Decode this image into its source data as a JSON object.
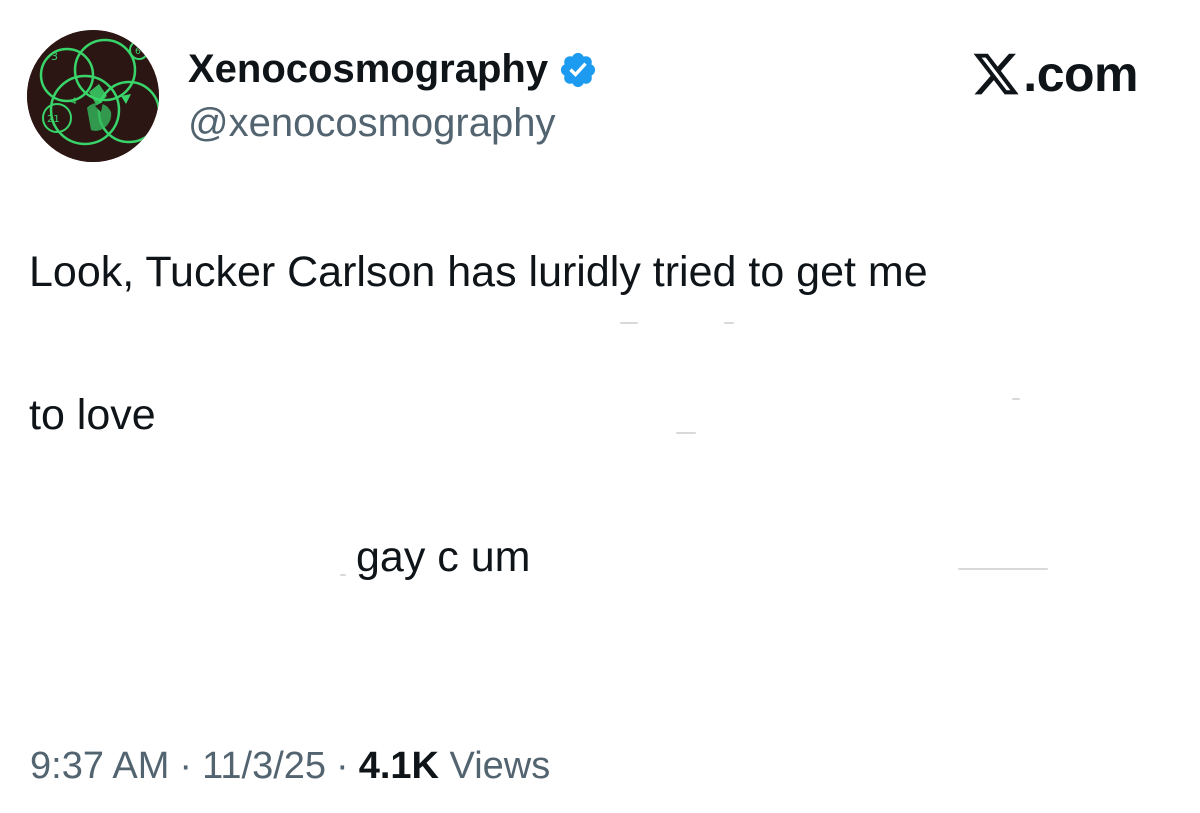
{
  "author": {
    "display_name": "Xenocosmography",
    "handle": "@xenocosmography",
    "verified": true,
    "verified_color": "#1d9bf0",
    "avatar_icon": "avatar-diagram-icon"
  },
  "brand": {
    "text": ".com",
    "logo_icon": "x-logo-icon"
  },
  "tweet": {
    "lines": [
      "Look, Tucker Carlson has luridly tried to get me",
      "to love",
      "gay c  um"
    ]
  },
  "meta": {
    "time": "9:37 AM",
    "separator": "·",
    "date": "11/3/25",
    "views_count": "4.1K",
    "views_label": "Views"
  },
  "colors": {
    "text_primary": "#0f1419",
    "text_secondary": "#536471",
    "background": "#ffffff"
  }
}
